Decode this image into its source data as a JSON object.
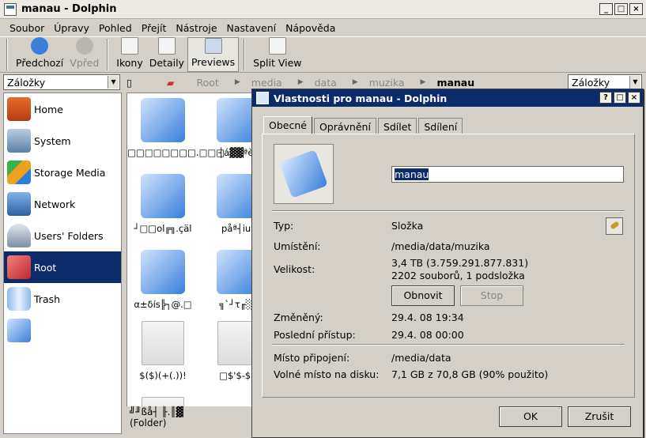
{
  "window": {
    "title": "manau - Dolphin"
  },
  "menu": [
    "Soubor",
    "Úpravy",
    "Pohled",
    "Přejít",
    "Nástroje",
    "Nastavení",
    "Nápověda"
  ],
  "toolbar": {
    "back": "Předchozí",
    "forward": "Vpřed",
    "icons": "Ikony",
    "details": "Detaily",
    "previews": "Previews",
    "split": "Split View"
  },
  "bookmarks_combo_left": "Záložky",
  "bookmarks_combo_right": "Záložky",
  "breadcrumb": [
    "Root",
    "media",
    "data",
    "muzika",
    "manau"
  ],
  "sidebar": {
    "items": [
      "Home",
      "System",
      "Storage Media",
      "Network",
      "Users' Folders",
      "Root",
      "Trash",
      ""
    ]
  },
  "files": [
    "□□□□□□□□.□□□",
    "┤á▓▓ªè4",
    "┘□□ol╔╗.çäl",
    "påª┤iuy",
    "α±δís╠┐@.□",
    "╗`┘τ╓░ä",
    "$($)(+(.))!",
    "□$'$-$#"
  ],
  "status": {
    "line1": "╝╜ßå┤ ╟.║▓",
    "line2": "(Folder)"
  },
  "dialog": {
    "title": "Vlastnosti pro manau - Dolphin",
    "tabs": [
      "Obecné",
      "Oprávnění",
      "Sdílet",
      "Sdílení"
    ],
    "name": "manau",
    "type_label": "Typ:",
    "type_value": "Složka",
    "location_label": "Umístění:",
    "location_value": "/media/data/muzika",
    "size_label": "Velikost:",
    "size_value1": "3,4 TB (3.759.291.877.831)",
    "size_value2": "2202 souborů, 1 podsložka",
    "refresh": "Obnovit",
    "stop": "Stop",
    "modified_label": "Změněný:",
    "modified_value": "29.4. 08 19:34",
    "accessed_label": "Poslední přístup:",
    "accessed_value": "29.4. 08 00:00",
    "mount_label": "Místo připojení:",
    "mount_value": "/media/data",
    "free_label": "Volné místo na disku:",
    "free_value": "7,1 GB z 70,8 GB (90% použito)",
    "ok": "OK",
    "cancel": "Zrušit"
  }
}
